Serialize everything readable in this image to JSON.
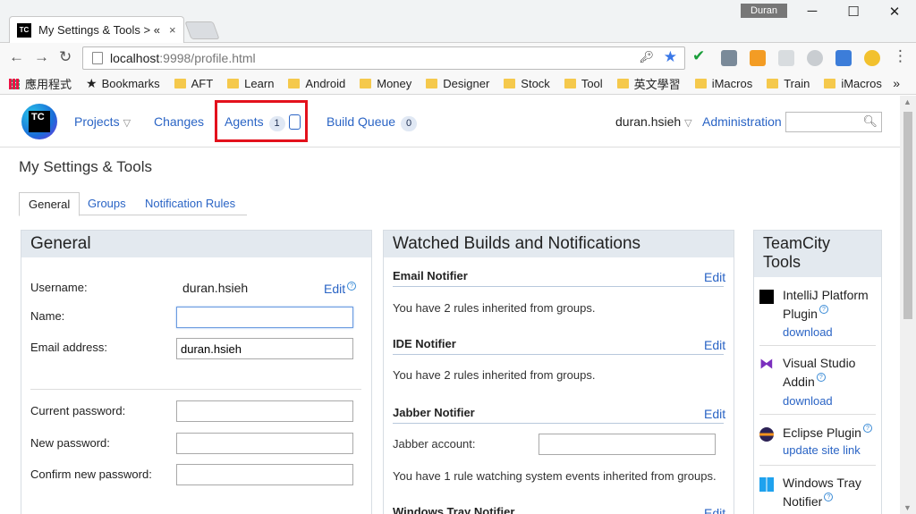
{
  "browser": {
    "tab_title": "My Settings & Tools > «",
    "tab_close": "×",
    "favicon_text": "TC",
    "user_badge": "Duran",
    "url_host": "localhost",
    "url_path": ":9998/profile.html",
    "bookmarks": [
      "應用程式",
      "Bookmarks",
      "AFT",
      "Learn",
      "Android",
      "Money",
      "Designer",
      "Stock",
      "Tool",
      "英文學習",
      "iMacros",
      "Train",
      "iMacros"
    ],
    "bookmarks_more": "»"
  },
  "header": {
    "logo_text": "TC",
    "projects": "Projects",
    "changes": "Changes",
    "agents": "Agents",
    "agents_count": "1",
    "build_queue": "Build Queue",
    "build_queue_count": "0",
    "user": "duran.hsieh",
    "administration": "Administration",
    "caret": "▽"
  },
  "page": {
    "title": "My Settings & Tools",
    "tabs": [
      "General",
      "Groups",
      "Notification Rules"
    ]
  },
  "general": {
    "heading": "General",
    "username_label": "Username:",
    "username_value": "duran.hsieh",
    "edit": "Edit",
    "name_label": "Name:",
    "name_value": "",
    "email_label": "Email address:",
    "email_value": "duran.hsieh",
    "current_password_label": "Current password:",
    "new_password_label": "New password:",
    "confirm_password_label": "Confirm new password:"
  },
  "watched": {
    "heading": "Watched Builds and Notifications",
    "edit": "Edit",
    "email_title": "Email Notifier",
    "email_text": "You have 2 rules inherited from groups.",
    "ide_title": "IDE Notifier",
    "ide_text": "You have 2 rules inherited from groups.",
    "jabber_title": "Jabber Notifier",
    "jabber_account_label": "Jabber account:",
    "jabber_text": "You have 1 rule watching system events inherited from groups.",
    "windows_title": "Windows Tray Notifier"
  },
  "tools": {
    "heading_line1": "TeamCity",
    "heading_line2": "Tools",
    "intellij_line1": "IntelliJ Platform",
    "intellij_line2": "Plugin",
    "download": "download",
    "vs_line1": "Visual Studio",
    "vs_line2": "Addin",
    "eclipse": "Eclipse Plugin",
    "update_site": "update site link",
    "tray_line1": "Windows Tray",
    "tray_line2": "Notifier"
  },
  "colors": {
    "link": "#2a64c5",
    "highlight": "#e3111c",
    "panel_header": "#e3e9ef"
  }
}
